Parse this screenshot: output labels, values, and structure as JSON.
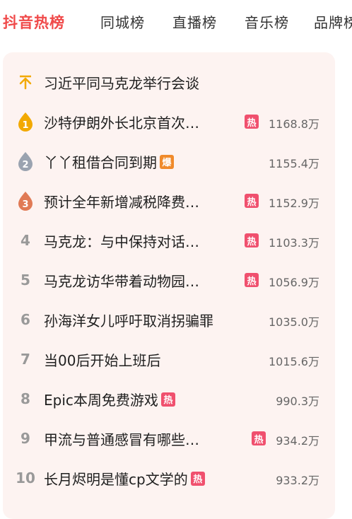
{
  "tabs": [
    "抖音热榜",
    "同城榜",
    "直播榜",
    "音乐榜",
    "品牌榜"
  ],
  "colors": {
    "accent": "#f04a4a",
    "hot_badge": "#f0506e",
    "boom_badge": "#f08a2a",
    "gold": "#f2a900",
    "silver": "#9aa3b0",
    "bronze": "#e07a55"
  },
  "pinned": {
    "icon": "pin-top-icon",
    "title": "习近平同马克龙举行会谈"
  },
  "items": [
    {
      "rank": "1",
      "title": "沙特伊朗外长北京首次…",
      "badge": "热",
      "heat": "1168.8万"
    },
    {
      "rank": "2",
      "title": "丫丫租借合同到期",
      "badge": "爆",
      "heat": "1155.4万"
    },
    {
      "rank": "3",
      "title": "预计全年新增减税降费…",
      "badge": "热",
      "heat": "1152.9万"
    },
    {
      "rank": "4",
      "title": "马克龙：与中保持对话…",
      "badge": "热",
      "heat": "1103.3万"
    },
    {
      "rank": "5",
      "title": "马克龙访华带着动物园…",
      "badge": "热",
      "heat": "1056.9万"
    },
    {
      "rank": "6",
      "title": "孙海洋女儿呼吁取消拐骗罪",
      "badge": "",
      "heat": "1035.0万"
    },
    {
      "rank": "7",
      "title": "当00后开始上班后",
      "badge": "",
      "heat": "1015.6万"
    },
    {
      "rank": "8",
      "title": "Epic本周免费游戏",
      "badge": "热",
      "heat": "990.3万"
    },
    {
      "rank": "9",
      "title": "甲流与普通感冒有哪些…",
      "badge": "热",
      "heat": "934.2万"
    },
    {
      "rank": "10",
      "title": "长月烬明是懂cp文学的",
      "badge": "热",
      "heat": "933.2万"
    }
  ]
}
